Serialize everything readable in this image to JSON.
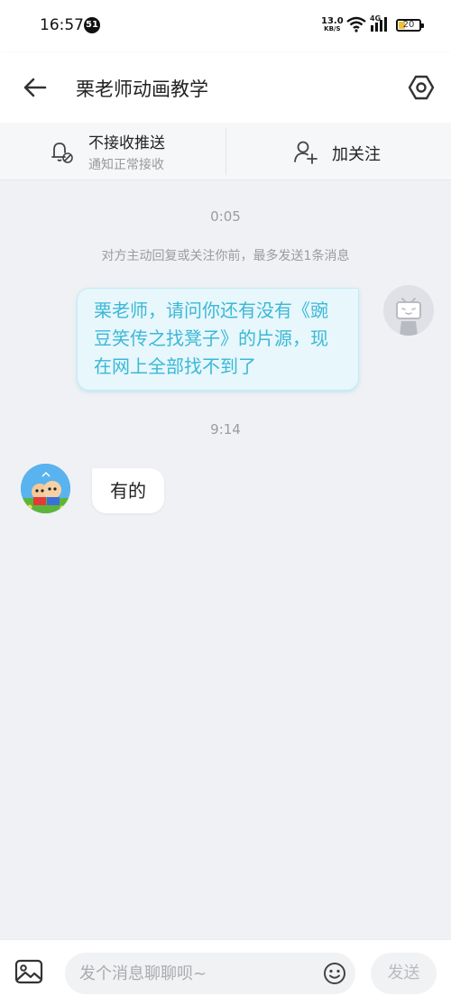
{
  "status_bar": {
    "time": "16:57",
    "notification_count": "51",
    "net_speed_value": "13.0",
    "net_speed_unit": "KB/S",
    "signal_label": "4G",
    "battery_level": "20"
  },
  "header": {
    "title": "栗老师动画教学"
  },
  "actions": {
    "push_title": "不接收推送",
    "push_subtitle": "通知正常接收",
    "follow_label": "加关注"
  },
  "chat": {
    "timestamp_1": "0:05",
    "notice": "对方主动回复或关注你前，最多发送1条消息",
    "sent_message": "栗老师，请问你还有没有《豌豆笑传之找凳子》的片源，现在网上全部找不到了",
    "timestamp_2": "9:14",
    "received_message": "有的"
  },
  "composer": {
    "placeholder": "发个消息聊聊呗~",
    "send_label": "发送"
  },
  "colors": {
    "accent": "#3bb8d6",
    "bubble_sent_bg": "#e7f7fc",
    "background": "#f0f1f4"
  },
  "icons": [
    "back-arrow-icon",
    "settings-hexagon-icon",
    "bell-muted-icon",
    "add-user-icon",
    "image-icon",
    "emoji-icon",
    "bilibili-tv-avatar-icon"
  ]
}
